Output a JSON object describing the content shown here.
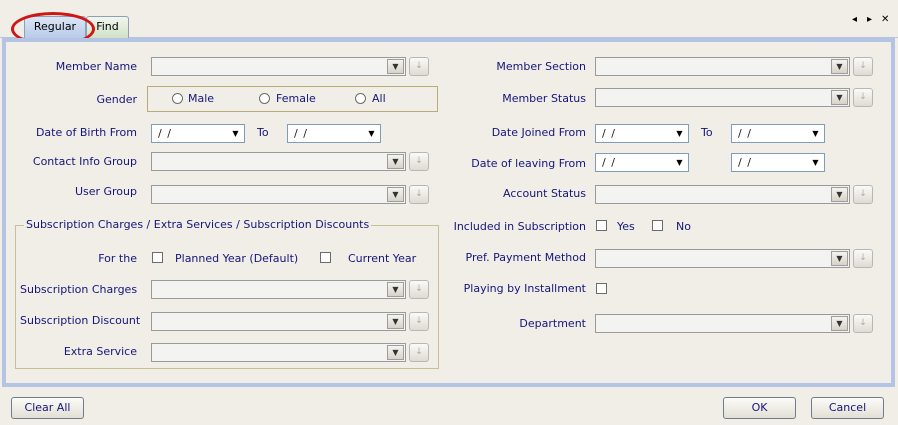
{
  "tabs": {
    "regular": "Regular",
    "find": "Find"
  },
  "nav": {
    "prev": "◂",
    "next": "▸",
    "close": "✕"
  },
  "left": {
    "member_name": "Member Name",
    "gender": "Gender",
    "gender_options": [
      "Male",
      "Female",
      "All"
    ],
    "dob_from": "Date of Birth From",
    "to": "To",
    "contact_info_group": "Contact Info Group",
    "user_group": "User Group",
    "subscription_box_title": "Subscription Charges / Extra Services /  Subscription Discounts",
    "for_the": "For the",
    "planned_year": "Planned Year (Default)",
    "current_year": "Current Year",
    "subscription_charges": "Subscription Charges",
    "subscription_discount": "Subscription Discount",
    "extra_service": "Extra Service"
  },
  "right": {
    "member_section": "Member Section",
    "member_status": "Member Status",
    "date_joined_from": "Date Joined From",
    "to": "To",
    "date_of_leaving_from": "Date of leaving From",
    "account_status": "Account Status",
    "included_in_subscription": "Included in Subscription",
    "yes": "Yes",
    "no": "No",
    "pref_payment_method": "Pref. Payment Method",
    "playing_by_installment": "Playing by Installment",
    "department": "Department"
  },
  "date_placeholder": "/ /",
  "buttons": {
    "clear_all": "Clear All",
    "ok": "OK",
    "cancel": "Cancel"
  },
  "colors": {
    "label": "#15157a",
    "panel_border": "#b3c4e4",
    "highlight": "#d01515"
  }
}
